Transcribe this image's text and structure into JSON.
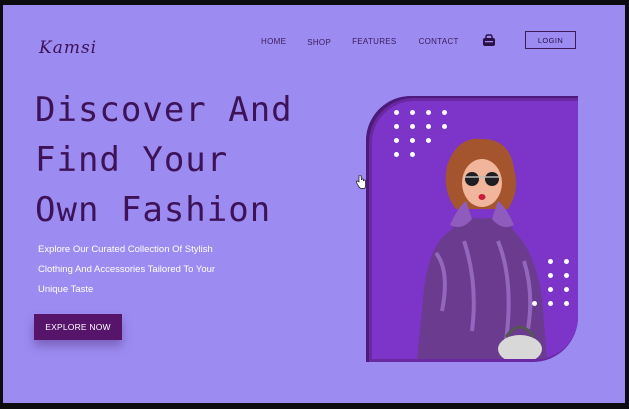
{
  "brand": {
    "logo": "Kamsi"
  },
  "nav": {
    "home": "HOME",
    "shop": "SHOP",
    "features": "FEATURES",
    "contact": "CONTACT"
  },
  "header": {
    "cart_icon": "cart-icon",
    "login_label": "LOGIN"
  },
  "hero": {
    "headline": [
      "Discover And",
      "Find Your",
      "Own Fashion"
    ],
    "description": [
      "Explore Our Curated Collection Of Stylish",
      "Clothing And Accessories Tailored To Your",
      "Unique Taste"
    ],
    "cta_label": "EXPLORE NOW"
  },
  "colors": {
    "page_background": "#9c8cf2",
    "accent_dark": "#56156a",
    "card": "#7c35c8",
    "text_dark": "#3d1257"
  }
}
